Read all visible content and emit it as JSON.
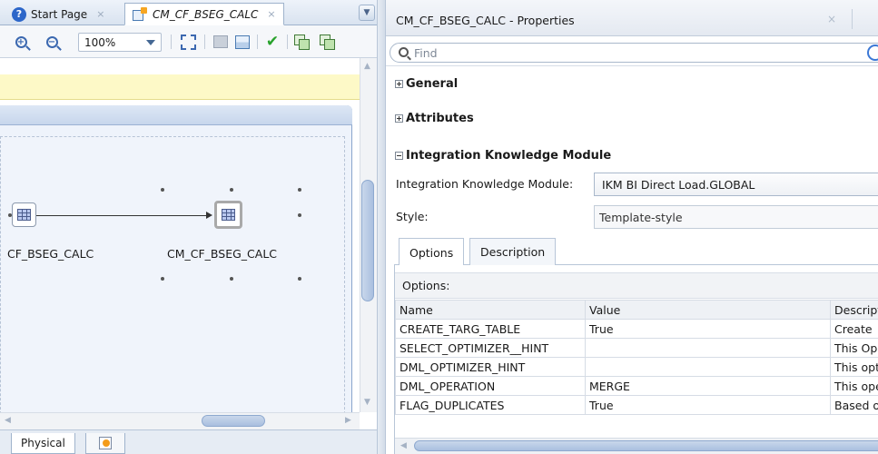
{
  "left_pane": {
    "tabs": [
      {
        "label": "Start Page",
        "close": "×"
      },
      {
        "label": "CM_CF_BSEG_CALC",
        "close": "×"
      }
    ],
    "toolbar": {
      "zoom_value": "100%"
    },
    "diagram": {
      "source_node_label": "CF_BSEG_CALC",
      "target_node_label": "CM_CF_BSEG_CALC"
    },
    "bottom_tabs": {
      "physical_label": "Physical"
    }
  },
  "properties": {
    "title": "CM_CF_BSEG_CALC - Properties",
    "close": "×",
    "find_placeholder": "Find",
    "sections": {
      "general": "General",
      "attributes": "Attributes",
      "ikm": "Integration Knowledge Module"
    },
    "ikm_label": "Integration Knowledge Module:",
    "ikm_value": "IKM BI Direct Load.GLOBAL",
    "style_label": "Style:",
    "style_value": "Template-style",
    "subtabs": [
      "Options",
      "Description"
    ],
    "options_header": "Options:",
    "grid": {
      "columns": [
        "Name",
        "Value",
        "Descript"
      ],
      "rows": [
        [
          "CREATE_TARG_TABLE",
          "True",
          "Create"
        ],
        [
          "SELECT_OPTIMIZER__HINT",
          "",
          "This Op"
        ],
        [
          "DML_OPTIMIZER_HINT",
          "",
          "This opt"
        ],
        [
          "DML_OPERATION",
          "MERGE",
          "This ope"
        ],
        [
          "FLAG_DUPLICATES",
          "True",
          "Based o"
        ]
      ]
    }
  },
  "icons": [
    "help-icon",
    "mapping-icon",
    "zoom-in-icon",
    "zoom-out-icon",
    "fit-to-window-icon",
    "layout-icon",
    "validate-check-icon",
    "copy-icon",
    "search-icon",
    "datastore-icon"
  ],
  "colors": {
    "accent": "#3b68b0",
    "validate": "#28a22c",
    "highlight": "#fdf9c7"
  }
}
